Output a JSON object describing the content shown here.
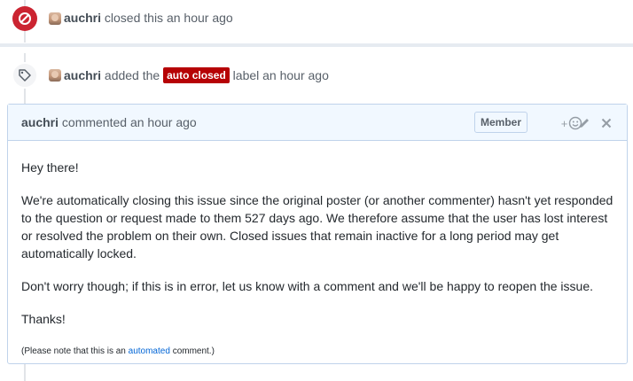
{
  "closed_event": {
    "author": "auchri",
    "text": "closed this an hour ago",
    "icon": "circle-slash-icon",
    "color": "#cb2431"
  },
  "label_event": {
    "author": "auchri",
    "before": "added the",
    "label": "auto closed",
    "label_color": "#b60205",
    "after": "label an hour ago",
    "icon": "tag-icon"
  },
  "comment": {
    "author": "auchri",
    "meta": "commented an hour ago",
    "role_badge": "Member",
    "reaction_plus": "+",
    "paragraphs": [
      "Hey there!",
      "We're automatically closing this issue since the original poster (or another commenter) hasn't yet responded to the question or request made to them 527 days ago. We therefore assume that the user has lost interest or resolved the problem on their own. Closed issues that remain inactive for a long period may get automatically locked.",
      "Don't worry though; if this is in error, let us know with a comment and we'll be happy to reopen the issue.",
      "Thanks!"
    ],
    "note_before": "(Please note that this is an",
    "note_link": "automated",
    "note_after": "comment.)"
  }
}
